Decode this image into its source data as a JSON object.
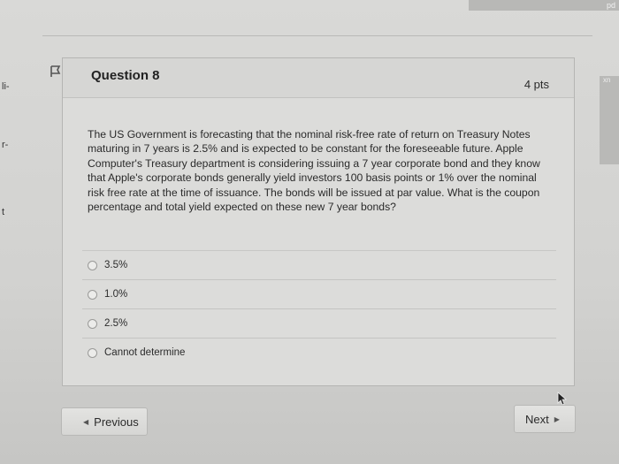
{
  "corner": {
    "text": "pd"
  },
  "side": {
    "left_1": "li-",
    "left_2": "r-",
    "left_3": "t",
    "right_1": "xn"
  },
  "question": {
    "title": "Question 8",
    "points": "4 pts",
    "body": "The US Government is forecasting that the nominal risk-free rate of return on Treasury Notes maturing in 7 years is 2.5% and is expected to be constant for the foreseeable future. Apple Computer's Treasury department is considering issuing a 7 year corporate bond and they know that Apple's corporate bonds generally yield investors 100 basis points or 1% over the nominal risk free rate  at the time of issuance. The bonds will be issued at par value. What is the coupon percentage and total yield expected on these new 7 year bonds?",
    "answers": [
      "3.5%",
      "1.0%",
      "2.5%",
      "Cannot determine"
    ]
  },
  "nav": {
    "previous_label": "Previous",
    "next_label": "Next"
  },
  "icons": {
    "flag": "flag-icon",
    "cursor": "cursor-icon",
    "prev_arrow": "triangle-left-icon",
    "next_arrow": "triangle-right-icon"
  },
  "colors": {
    "background": "#d2d2d0",
    "card": "#dcdcda",
    "text": "#2b2b2b"
  }
}
